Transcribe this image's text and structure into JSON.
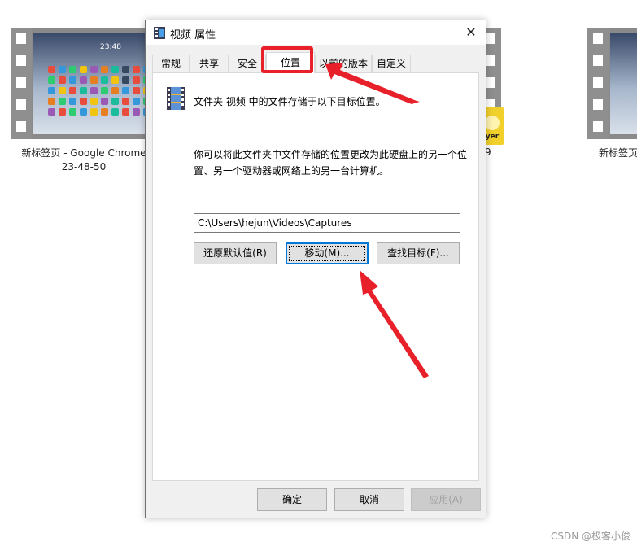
{
  "dialog": {
    "title": "视频 属性",
    "close_glyph": "✕",
    "tabs": [
      {
        "label": "常规"
      },
      {
        "label": "共享"
      },
      {
        "label": "安全"
      },
      {
        "label": "位置"
      },
      {
        "label": "以前的版本"
      },
      {
        "label": "自定义"
      }
    ],
    "active_tab": "位置",
    "location": {
      "description": "文件夹 视频 中的文件存储于以下目标位置。",
      "info": "你可以将此文件夹中文件存储的位置更改为此硬盘上的另一个位置、另一个驱动器或网络上的另一台计算机。",
      "path": "C:\\Users\\hejun\\Videos\\Captures",
      "restore_button": "还原默认值(R)",
      "move_button": "移动(M)...",
      "find_button": "查找目标(F)..."
    },
    "footer": {
      "ok": "确定",
      "cancel": "取消",
      "apply": "应用(A)"
    }
  },
  "background": {
    "thumbnails": [
      {
        "label_line1": "新标签页 - Google Chrome",
        "label_line2": "23-48-50",
        "clock": "23:48"
      },
      {
        "label_partial": "9",
        "badge_text": "ayer"
      },
      {
        "label_partial": "新标签页"
      }
    ]
  },
  "annotation": {
    "highlight_color": "#e8202a"
  },
  "watermark": "CSDN @极客小俊"
}
